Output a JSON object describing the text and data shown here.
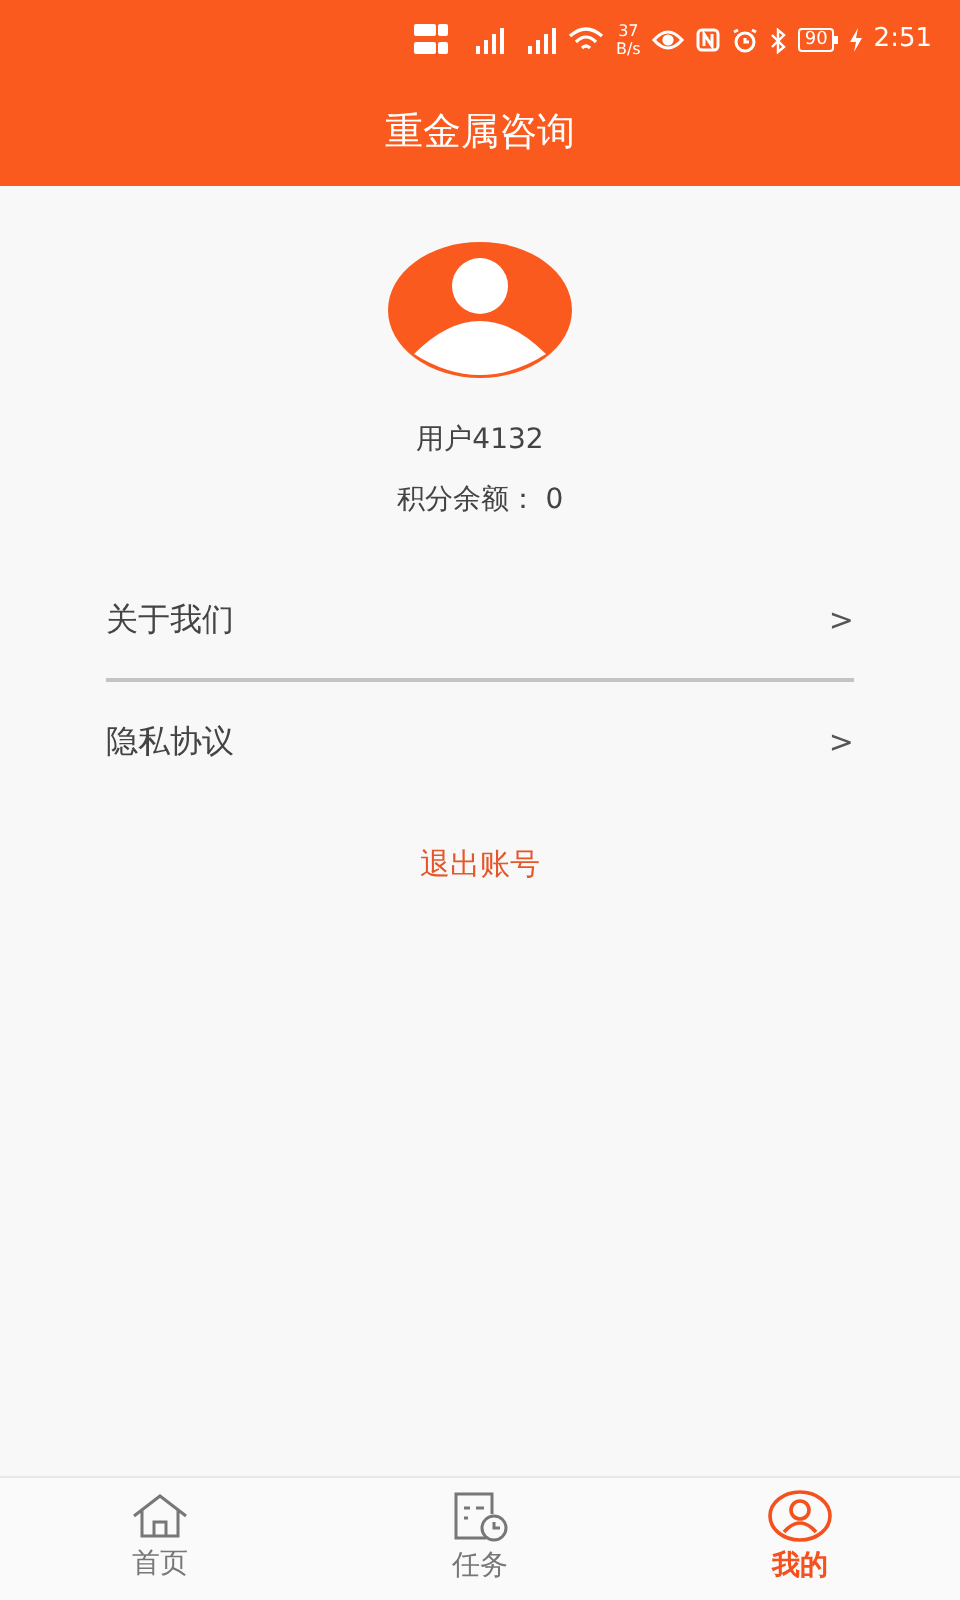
{
  "status_bar": {
    "speed": "37",
    "speed_unit": "B/s",
    "battery": "90",
    "time": "2:51"
  },
  "header": {
    "title": "重金属咨询"
  },
  "profile": {
    "username": "用户4132",
    "points": "积分余额： 0"
  },
  "menu": [
    {
      "label": "关于我们",
      "arrow": ">",
      "divider": true
    },
    {
      "label": "隐私协议",
      "arrow": ">",
      "divider": false
    }
  ],
  "logout": "退出账号",
  "tabs": [
    {
      "label": "首页",
      "kind": "home",
      "selected": false
    },
    {
      "label": "任务",
      "kind": "task",
      "selected": false
    },
    {
      "label": "我的",
      "kind": "user",
      "selected": true
    }
  ]
}
